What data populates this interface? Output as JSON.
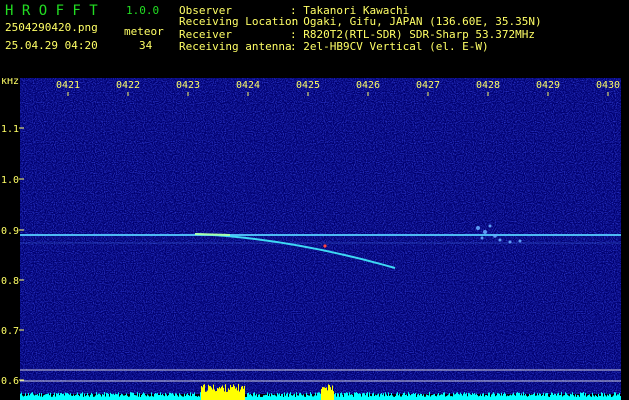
{
  "app": {
    "name": "H R O F F T",
    "version": "1.0.0"
  },
  "file": {
    "name": "2504290420.png",
    "datetime": "25.04.29 04:20"
  },
  "counter": {
    "label": "meteor",
    "value": "34"
  },
  "station": {
    "observer_label": "Observer",
    "observer_value": ": Takanori Kawachi",
    "location_label": "Receiving Location",
    "location_value": ": Ogaki, Gifu, JAPAN (136.60E, 35.35N)",
    "receiver_label": "Receiver",
    "receiver_value": ": R820T2(RTL-SDR) SDR-Sharp 53.372MHz",
    "antenna_label": "Receiving antenna",
    "antenna_value": ": 2el-HB9CV Vertical (el. E-W)"
  },
  "axis": {
    "y_unit": "kHz",
    "y_ticks": [
      "1.1",
      "1.0",
      "0.9",
      "0.8",
      "0.7",
      "0.6"
    ],
    "x_ticks": [
      "0421",
      "0422",
      "0423",
      "0424",
      "0425",
      "0426",
      "0427",
      "0428",
      "0429",
      "0430"
    ]
  },
  "colors": {
    "title": "#22dd22",
    "text": "#ffffff",
    "accent_text": "#ffff66",
    "background": "#00007a",
    "carrier": "#55ccff",
    "level_bar": "#00ffff",
    "level_peak": "#ffff00"
  }
}
